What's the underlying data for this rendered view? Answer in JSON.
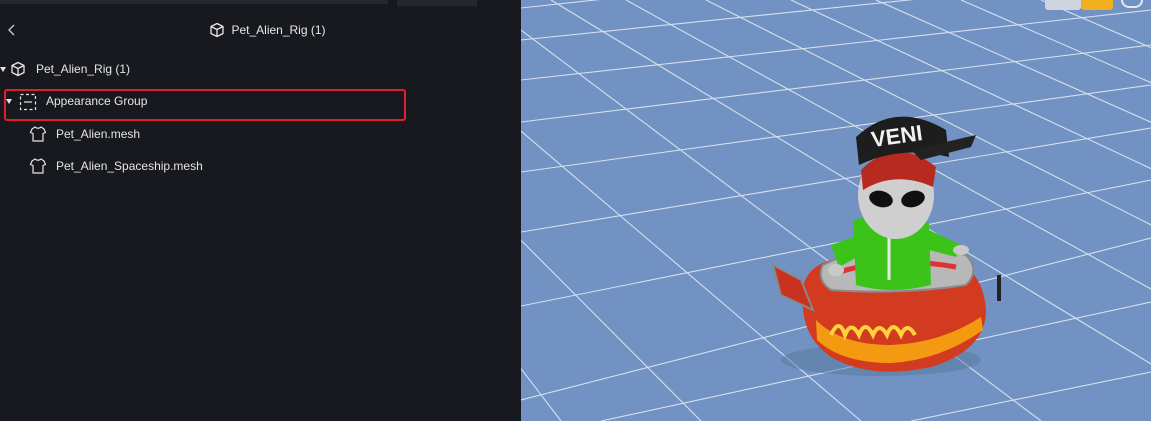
{
  "header": {
    "title": "Pet_Alien_Rig (1)",
    "back_icon": "chevron-left-icon",
    "title_icon": "cube-icon"
  },
  "tree": {
    "root": {
      "label": "Pet_Alien_Rig (1)",
      "icon": "cube-icon",
      "expanded": true
    },
    "group": {
      "label": "Appearance Group",
      "icon": "group-dashed-icon",
      "expanded": true,
      "highlighted": true
    },
    "meshes": [
      {
        "label": "Pet_Alien.mesh",
        "icon": "shirt-icon"
      },
      {
        "label": "Pet_Alien_Spaceship.mesh",
        "icon": "shirt-icon"
      }
    ]
  },
  "viewport": {
    "background": "#7192c2",
    "grid_color": "#e9eef6",
    "model_cap_text": "VENI"
  },
  "colors": {
    "panel_bg": "#17191e",
    "highlight_border": "#e0202a",
    "accent_tool": "#f0b020"
  }
}
